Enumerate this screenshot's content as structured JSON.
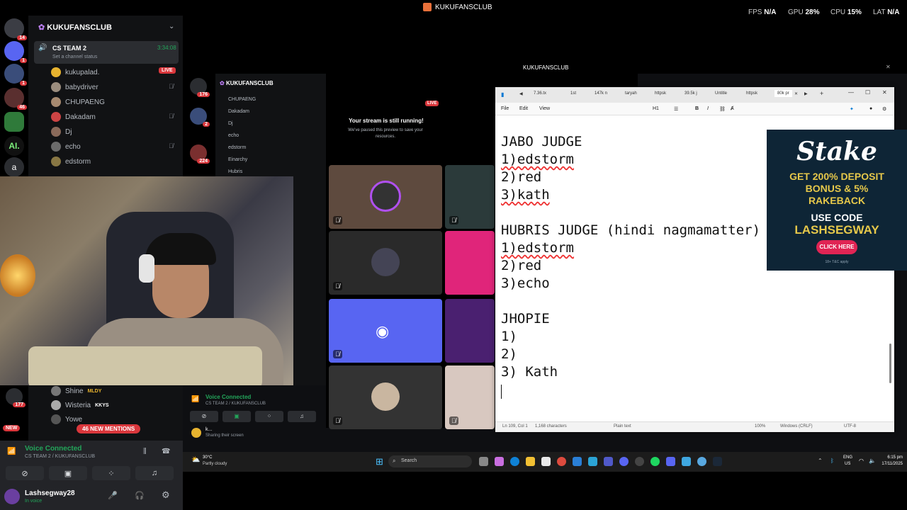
{
  "topbar": {
    "title": "KUKUFANSCLUB",
    "fps_label": "FPS",
    "fps_value": "N/A",
    "gpu_label": "GPU",
    "gpu_value": "28%",
    "cpu_label": "CPU",
    "cpu_value": "15%",
    "lat_label": "LAT",
    "lat_value": "N/A"
  },
  "rail": {
    "badges": [
      "14",
      "1",
      "1",
      "46"
    ],
    "labels": [
      "AI.",
      "a"
    ]
  },
  "left_panel": {
    "server_name": "KUKUFANSCLUB",
    "stage": {
      "name": "CS TEAM 2",
      "time": "3:34:08",
      "status": "Set a channel status"
    },
    "members": [
      {
        "name": "kukupalad.",
        "badge": "LIVE"
      },
      {
        "name": "babydriver"
      },
      {
        "name": "CHUPAENG"
      },
      {
        "name": "Dakadam"
      },
      {
        "name": "Dj"
      },
      {
        "name": "echo"
      },
      {
        "name": "edstorm"
      }
    ],
    "lower_members": [
      {
        "name": "Shine",
        "tag": "MLDY"
      },
      {
        "name": "Wisteria",
        "tag": "KKYS"
      },
      {
        "name": "Yowe"
      }
    ],
    "mentions": "46 NEW MENTIONS",
    "rail_badges_low": [
      "177",
      "NEW"
    ],
    "voice": {
      "title": "Voice Connected",
      "sub": "CS TEAM 2 / KUKUFANSCLUB"
    },
    "user": {
      "name": "Lashsegway28",
      "status": "In voice"
    }
  },
  "window2": {
    "title": "KUKUFANSCLUB",
    "server_name": "KUKUFANSCLUB",
    "rail_badges": [
      "176",
      "2",
      "224"
    ],
    "members": [
      "CHUPAENG",
      "Dakadam",
      "Dj",
      "echo",
      "edstorm",
      "Einarchy",
      "Hubris"
    ],
    "stream_notice_title": "Your stream is still running!",
    "stream_notice_body": "We've paused this preview to save your resources.",
    "live": "LIVE",
    "voice": {
      "title": "Voice Connected",
      "sub": "CS TEAM 2 / KUKUFANSCLUB"
    },
    "share_user": {
      "name": "k...",
      "status": "Sharing their screen"
    }
  },
  "notepad": {
    "tabs": [
      "7.36.tx",
      "1st",
      "147k n",
      "taryah",
      "httpsk",
      "39.5k j",
      "Untitle",
      "httpsk",
      "80k pr"
    ],
    "menu": [
      "File",
      "Edit",
      "View"
    ],
    "heading_btn": "H1",
    "lines": [
      "JABO JUDGE",
      "1)edstorm",
      "2)red",
      "3)kath",
      "",
      "HUBRIS JUDGE (hindi nagmamatter)",
      "1)edstorm",
      "2)red",
      "3)echo",
      "",
      "JHOPIE",
      "1)",
      "2)",
      "3) Kath",
      ""
    ],
    "status": {
      "pos": "Ln 109, Col 1",
      "chars": "1,168 characters",
      "format": "Plain text",
      "zoom": "100%",
      "eol": "Windows (CRLF)",
      "enc": "UTF-8"
    }
  },
  "ad": {
    "brand": "Stake",
    "line1": "GET 200% DEPOSIT",
    "line2": "BONUS & 5%",
    "line3": "RAKEBACK",
    "code_label": "USE CODE",
    "code": "LASHSEGWAY",
    "cta": "CLICK HERE",
    "fine": "18+ T&C apply"
  },
  "taskbar": {
    "weather_temp": "30°C",
    "weather_desc": "Partly cloudy",
    "search": "Search",
    "lang1": "ENG",
    "lang2": "US",
    "time": "6:15 pm",
    "date": "17/11/2025"
  },
  "colors": {
    "discord_blurple": "#5865f2",
    "live_red": "#da373c",
    "voice_green": "#23a55a",
    "stake_gold": "#e6c84a"
  }
}
